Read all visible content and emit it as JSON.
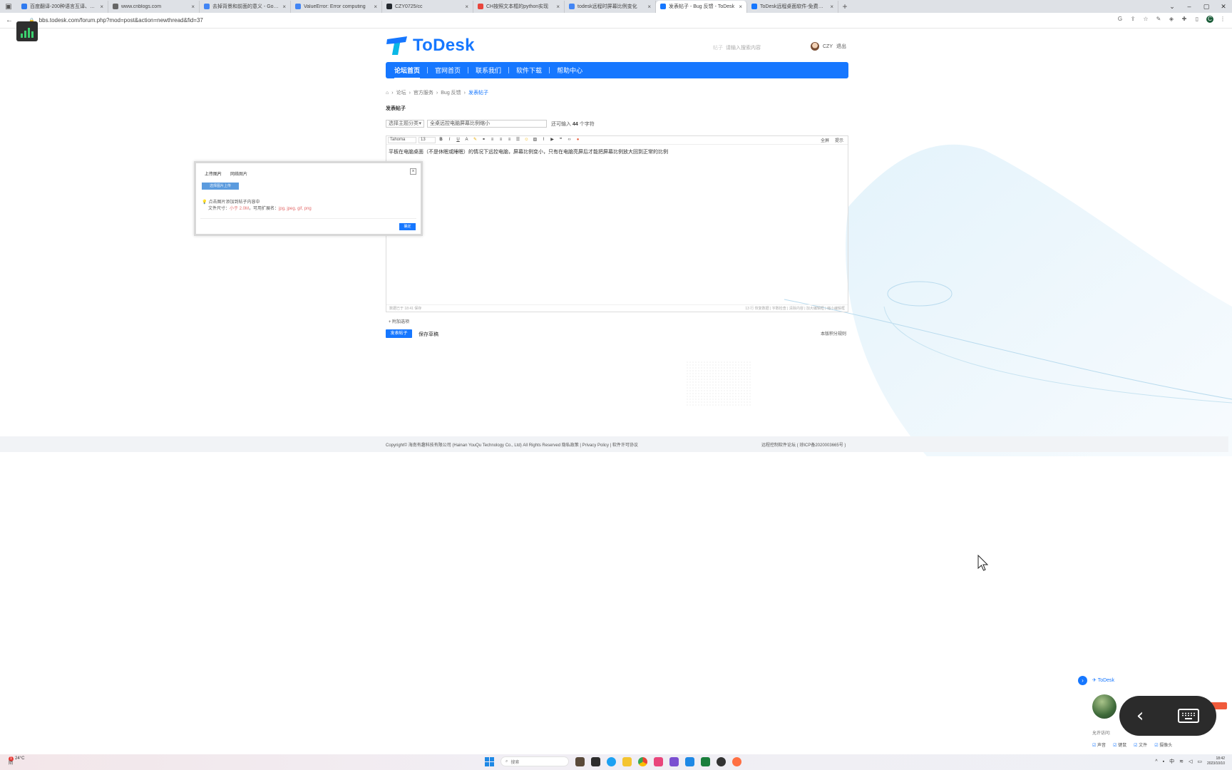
{
  "browser": {
    "tabs": [
      {
        "title": "百度翻译-200种语言互译、沟通全世界！",
        "color": "#2f7bf0",
        "active": false
      },
      {
        "title": "www.cnblogs.com",
        "color": "#666666",
        "active": false
      },
      {
        "title": "去掉背景和前面的意义 - Google",
        "color": "#4285f4",
        "active": false
      },
      {
        "title": "ValueError: Error computing",
        "color": "#4285f4",
        "active": false
      },
      {
        "title": "CZY0725/cc",
        "color": "#24292f",
        "active": false
      },
      {
        "title": "CH按照文本框的python实现",
        "color": "#e8453c",
        "active": false
      },
      {
        "title": "todesk远程时屏幕比例变化",
        "color": "#4285f4",
        "active": false
      },
      {
        "title": "发表帖子 - Bug 反馈 - ToDesk",
        "color": "#1677ff",
        "active": true
      },
      {
        "title": "ToDesk远程桌面软件-免费安全",
        "color": "#1677ff",
        "active": false
      }
    ],
    "url": "bbs.todesk.com/forum.php?mod=post&action=newthread&fid=37"
  },
  "header": {
    "brand": "ToDesk",
    "search_placeholder": "请输入搜索内容",
    "search_scope": "帖子",
    "username": "CZY",
    "logout": "退出"
  },
  "nav": [
    {
      "label": "论坛首页",
      "current": true
    },
    {
      "label": "官网首页",
      "current": false
    },
    {
      "label": "联系我们",
      "current": false
    },
    {
      "label": "软件下载",
      "current": false
    },
    {
      "label": "帮助中心",
      "current": false
    }
  ],
  "breadcrumb": [
    "论坛",
    "官方服务",
    "Bug 反馈",
    "发表帖子"
  ],
  "page_title": "发表帖子",
  "subject": {
    "type_select": "选择主题分类",
    "value": "全桌远控电脑屏幕比例缩小",
    "remain_prefix": "还可输入",
    "remain_count": "44",
    "remain_suffix": "个字符"
  },
  "editor": {
    "font": "Tahoma",
    "size": "13",
    "toolbar_right": [
      "全屏",
      "提示"
    ],
    "content": "平板在电脑桌面（不是休眠或睡眠）的情况下远控电脑，屏幕比例变小，只有在电脑亮屏后才能把屏幕比例放大回到正常的比例",
    "status_left": "数据已于 18:41 保存",
    "status_right": "13 行 恢复数据 | 字数检查 | 清除内容 | 加大编辑框 | 缩小编辑框"
  },
  "attach_label": "附加选项",
  "submit_label": "发表帖子",
  "save_draft_label": "保存草稿",
  "rules_label": "本版积分规则",
  "dialog": {
    "tabs": [
      "上传图片",
      "网络图片"
    ],
    "upload_button": "选择图片上传",
    "hint_line1": "点击图片添加到帖子内容中",
    "size_prefix": "文件尺寸：",
    "size_value": "小于 2.0M",
    "ext_prefix": "，可用扩展名：",
    "ext_value": "jpg, jpeg, gif, png",
    "ok_button": "确定"
  },
  "footer": {
    "copyright": "Copyright© 海南有趣科技有限公司 (Hainan YouQu Technology Co., Ltd) All Rights Reserved 隐私政策 | Privacy Policy | 软件许可协议",
    "icp": "远程控制软件论坛 ( 琼ICP备2020003665号 )"
  },
  "todesk_panel": {
    "title": "ToDesk",
    "allow_label": "允许访问:",
    "permissions": [
      "声音",
      "键鼠",
      "文件",
      "摄像头"
    ]
  },
  "taskbar": {
    "temp": "24°C",
    "weather": "阴",
    "notifications": "1",
    "search_label": "搜索",
    "ime": "中",
    "time": "18:42",
    "date": "2023/10/10"
  },
  "colors": {
    "accent": "#1677ff",
    "footer_bg": "#f1f3f6"
  }
}
